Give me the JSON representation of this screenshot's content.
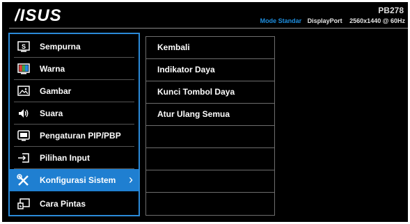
{
  "brand": "ASUS",
  "model": "PB278",
  "status": {
    "mode": "Mode Standar",
    "input": "DisplayPort",
    "resolution": "2560x1440 @ 60Hz"
  },
  "menu": [
    {
      "label": "Sempurna",
      "icon": "splendid-icon"
    },
    {
      "label": "Warna",
      "icon": "color-icon"
    },
    {
      "label": "Gambar",
      "icon": "image-icon"
    },
    {
      "label": "Suara",
      "icon": "speaker-icon"
    },
    {
      "label": "Pengaturan PIP/PBP",
      "icon": "pip-icon"
    },
    {
      "label": "Pilihan Input",
      "icon": "input-icon"
    },
    {
      "label": "Konfigurasi Sistem",
      "icon": "wrench-icon",
      "selected": true
    },
    {
      "label": "Cara Pintas",
      "icon": "shortcut-icon"
    }
  ],
  "submenu": [
    "Kembali",
    "Indikator Daya",
    "Kunci Tombol Daya",
    "Atur Ulang Semua",
    "",
    "",
    "",
    ""
  ],
  "colors": {
    "accent": "#1f7fd1",
    "mode_text": "#1e8fe0",
    "background": "#000000"
  }
}
